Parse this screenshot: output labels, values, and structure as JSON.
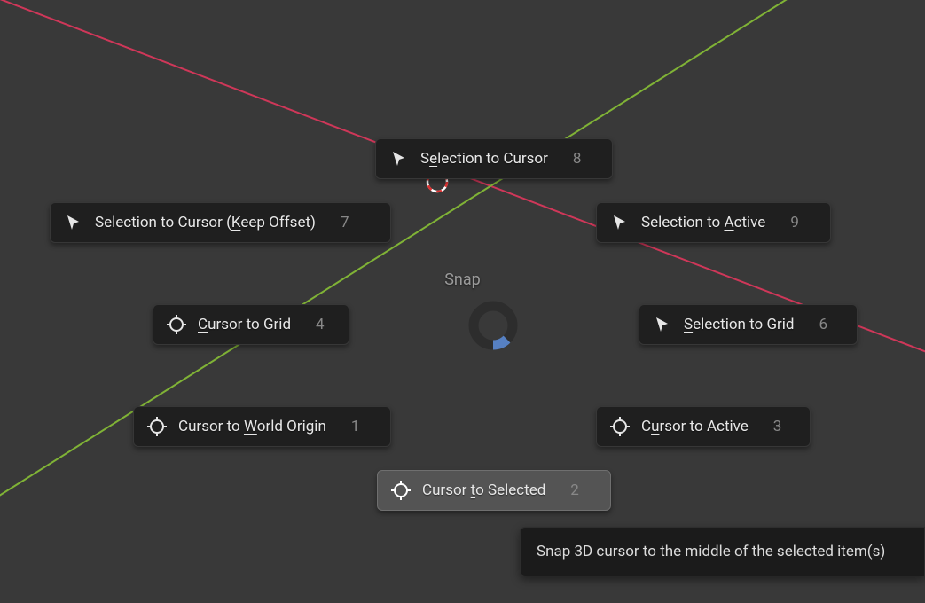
{
  "menu_title": "Snap",
  "items": {
    "sel_to_cursor": {
      "pre": "S",
      "u": "e",
      "post": "lection to Cursor",
      "shortcut": "8"
    },
    "sel_to_cursor_keep": {
      "pre": "Selection to Cursor (",
      "u": "K",
      "post": "eep Offset)",
      "shortcut": "7"
    },
    "sel_to_active": {
      "pre": "Selection to ",
      "u": "A",
      "post": "ctive",
      "shortcut": "9"
    },
    "cursor_to_grid": {
      "pre": "",
      "u": "C",
      "post": "ursor to Grid",
      "shortcut": "4"
    },
    "sel_to_grid": {
      "pre": "",
      "u": "S",
      "post": "election to Grid",
      "shortcut": "6"
    },
    "cursor_to_world": {
      "pre": "Cursor to ",
      "u": "W",
      "post": "orld Origin",
      "shortcut": "1"
    },
    "cursor_to_active": {
      "pre": "C",
      "u": "u",
      "post": "rsor to Active",
      "shortcut": "3"
    },
    "cursor_to_selected": {
      "pre": "Cursor ",
      "u": "t",
      "post": "o Selected",
      "shortcut": "2"
    }
  },
  "tooltip": "Snap 3D cursor to the middle of the selected item(s)",
  "colors": {
    "axis_x": "#cf3759",
    "axis_y": "#80b336",
    "highlight_arc": "#5680c2"
  }
}
